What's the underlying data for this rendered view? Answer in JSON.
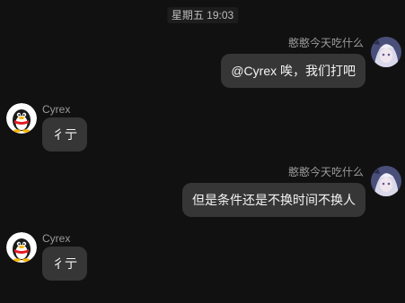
{
  "chat": {
    "timestamp": "星期五 19:03",
    "messages": [
      {
        "direction": "out",
        "sender": "憨憨今天吃什么",
        "text": "@Cyrex 唉，我们打吧",
        "avatar": "anime-girl-avatar"
      },
      {
        "direction": "in",
        "sender": "Cyrex",
        "text": "彳亍",
        "avatar": "qq-penguin-avatar"
      },
      {
        "direction": "out",
        "sender": "憨憨今天吃什么",
        "text": "但是条件还是不换时间不换人",
        "avatar": "anime-girl-avatar"
      },
      {
        "direction": "in",
        "sender": "Cyrex",
        "text": "彳亍",
        "avatar": "qq-penguin-avatar"
      }
    ]
  },
  "colors": {
    "background": "#111111",
    "bubble": "#363636",
    "sender_text": "#9a9a9a",
    "message_text": "#f4f4f4"
  }
}
